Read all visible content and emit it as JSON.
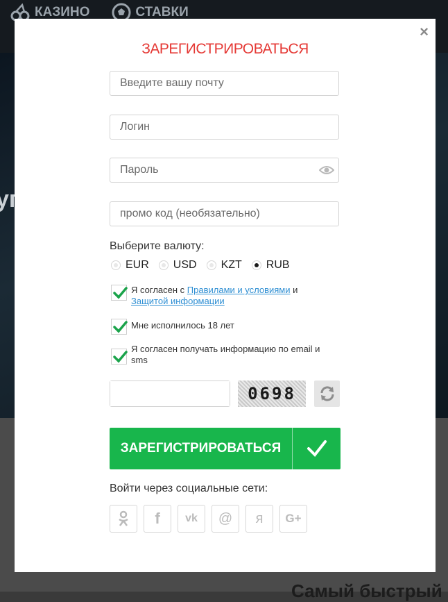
{
  "background": {
    "nav": [
      {
        "label": "КАЗИНО",
        "icon": "cherries-icon"
      },
      {
        "label": "СТАВКИ",
        "icon": "soccer-ball-icon"
      }
    ],
    "hero_fragment": "уг",
    "footer_fragment": "Самый быстрый"
  },
  "modal": {
    "title": "ЗАРЕГИСТРИРОВАТЬСЯ",
    "close_label": "×",
    "email_placeholder": "Введите вашу почту",
    "login_placeholder": "Логин",
    "password_placeholder": "Пароль",
    "promo_placeholder": "промо код (необязательно)",
    "currency_label": "Выберите валюту:",
    "currencies": [
      {
        "label": "EUR",
        "selected": false
      },
      {
        "label": "USD",
        "selected": false
      },
      {
        "label": "KZT",
        "selected": false
      },
      {
        "label": "RUB",
        "selected": true
      }
    ],
    "terms": {
      "prefix": "Я согласен с ",
      "rules_link": "Правилами и условиями",
      "and": " и ",
      "privacy_link": "Защитой информации",
      "checked": true
    },
    "age_label": "Мне исполнилось 18 лет",
    "age_checked": true,
    "newsletter_label": "Я согласен получать информацию по email и sms",
    "newsletter_checked": true,
    "captcha_code": "0698",
    "submit_label": "ЗАРЕГИСТРИРОВАТЬСЯ",
    "social_label": "Войти через социальные сети:",
    "social": [
      {
        "name": "odnoklassniki",
        "glyph": "ок"
      },
      {
        "name": "facebook",
        "glyph": "f"
      },
      {
        "name": "vkontakte",
        "glyph": "vk"
      },
      {
        "name": "mail",
        "glyph": "@"
      },
      {
        "name": "yandex",
        "glyph": "я"
      },
      {
        "name": "google-plus",
        "glyph": "G+"
      }
    ]
  },
  "colors": {
    "accent_red": "#e53935",
    "button_green": "#18b64c",
    "link_blue": "#2f8fd3",
    "check_green": "#1aa34a"
  }
}
